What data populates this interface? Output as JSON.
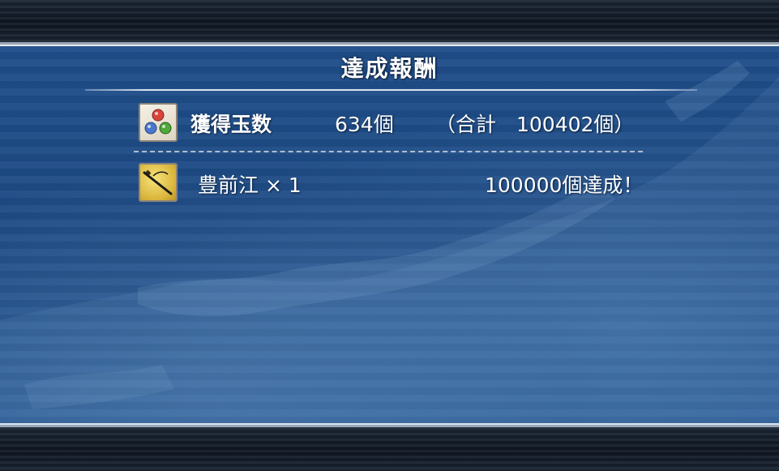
{
  "title": "達成報酬",
  "orbs_row": {
    "icon": "tri-orb-icon",
    "label": "獲得玉数",
    "count": "634個",
    "total_open": "（合計",
    "total_value": "100402個）"
  },
  "reward_row": {
    "icon": "sword-icon",
    "item": "豊前江 × 1",
    "status": "100000個達成！"
  },
  "colors": {
    "panel_blue": "#1f4e8a",
    "frame_gray": "#9aa6b4",
    "text": "#ffffff",
    "orb_red": "#d9443a",
    "orb_blue": "#4a78d0",
    "orb_green": "#4ea83a",
    "scroll_gold": "#e8c84a"
  }
}
